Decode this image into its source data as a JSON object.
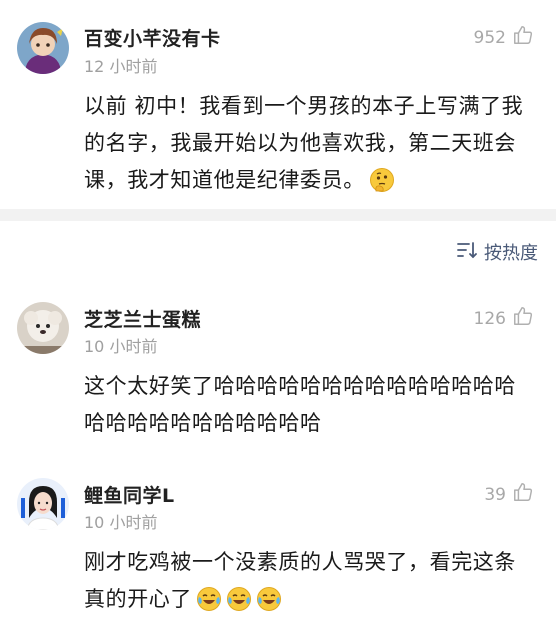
{
  "pinned_comment": {
    "username": "百变小芊没有卡",
    "time": "12 小时前",
    "likes": "952",
    "text": "以前 初中！我看到一个男孩的本子上写满了我的名字，我最开始以为他喜欢我，第二天班会课，我才知道他是纪律委员。",
    "emoji": "thinking-face"
  },
  "sort": {
    "label": "按热度"
  },
  "comments": [
    {
      "username": "芝芝兰士蛋糕",
      "time": "10 小时前",
      "likes": "126",
      "text": "这个太好笑了哈哈哈哈哈哈哈哈哈哈哈哈哈哈哈哈哈哈哈哈哈哈哈哈哈"
    },
    {
      "username": "鲤鱼同学L",
      "time": "10 小时前",
      "likes": "39",
      "text": "刚才吃鸡被一个没素质的人骂哭了，看完这条真的开心了",
      "emoji": "crying-laughing-face"
    }
  ],
  "colors": {
    "divider": "#f2f2f2",
    "muted": "#a0a0a0",
    "sort": "#4a5a78"
  }
}
